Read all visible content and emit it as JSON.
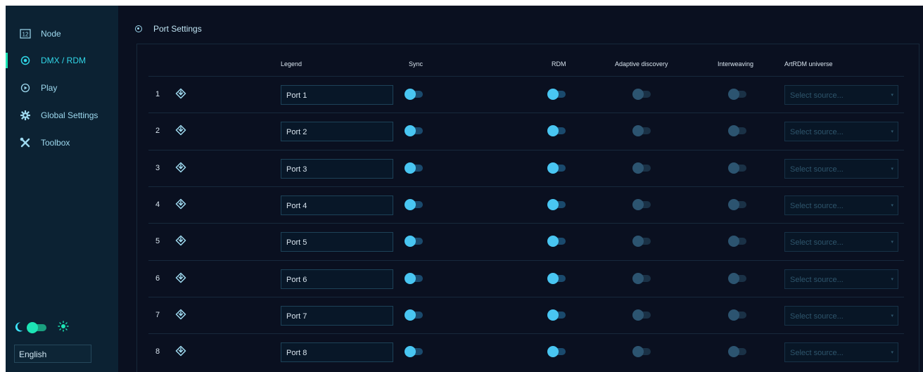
{
  "sidebar": {
    "items": [
      {
        "label": "Node",
        "icon": "node-icon"
      },
      {
        "label": "DMX / RDM",
        "icon": "radio-target-icon",
        "active": true
      },
      {
        "label": "Play",
        "icon": "play-circle-icon"
      },
      {
        "label": "Global Settings",
        "icon": "gear-icon"
      },
      {
        "label": "Toolbox",
        "icon": "tools-icon"
      }
    ],
    "node_icon_text": "12",
    "theme": {
      "dark_icon": "moon-icon",
      "light_icon": "sun-icon",
      "mode": "dark"
    },
    "language": "English"
  },
  "main": {
    "title": "Port Settings",
    "columns": {
      "legend": "Legend",
      "sync": "Sync",
      "rdm": "RDM",
      "adaptive": "Adaptive discovery",
      "interweaving": "Interweaving",
      "artrdm": "ArtRDM universe"
    },
    "rows": [
      {
        "num": "1",
        "legend": "Port 1",
        "placeholder": "Select source..."
      },
      {
        "num": "2",
        "legend": "Port 2",
        "placeholder": "Select source..."
      },
      {
        "num": "3",
        "legend": "Port 3",
        "placeholder": "Select source..."
      },
      {
        "num": "4",
        "legend": "Port 4",
        "placeholder": "Select source..."
      },
      {
        "num": "5",
        "legend": "Port 5",
        "placeholder": "Select source..."
      },
      {
        "num": "6",
        "legend": "Port 6",
        "placeholder": "Select source..."
      },
      {
        "num": "7",
        "legend": "Port 7",
        "placeholder": "Select source..."
      },
      {
        "num": "8",
        "legend": "Port 8",
        "placeholder": "Select source..."
      }
    ]
  },
  "colors": {
    "background": "#0a1020",
    "sidebar": "#0c2233",
    "accent": "#49c6f2",
    "active_nav": "#31d7e8",
    "theme_toggle": "#1de4b5"
  }
}
